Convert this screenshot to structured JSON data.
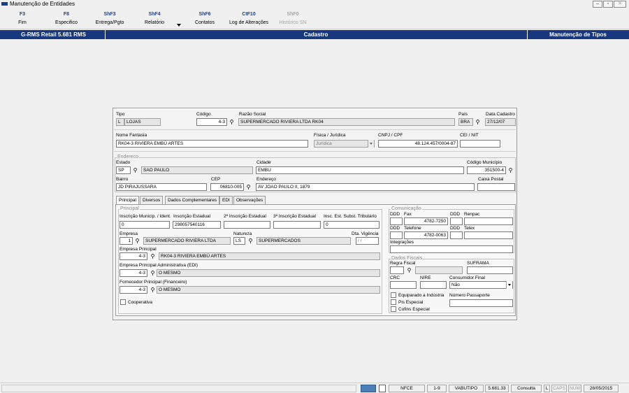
{
  "window": {
    "title": "Manutenção de Entidades"
  },
  "toolbar": [
    {
      "key": "F3",
      "label": "Fim",
      "enabled": true
    },
    {
      "key": "F8",
      "label": "Especifico",
      "enabled": true
    },
    {
      "key": "ShF3",
      "label": "Entrega/Pgto",
      "enabled": true
    },
    {
      "key": "ShF4",
      "label": "Relatório",
      "enabled": true
    },
    {
      "key": "ShF6",
      "label": "Contatos",
      "enabled": true
    },
    {
      "key": "CtF10",
      "label": "Log de Alterações",
      "enabled": true
    },
    {
      "key": "ShF0",
      "label": "Histórico SN",
      "enabled": false
    }
  ],
  "header": {
    "left": "G-RMS Retail 5.681 RMS",
    "center": "Cadastro",
    "right": "Manutenção de Tipos"
  },
  "form": {
    "tipo": {
      "label": "Tipo",
      "code": "L",
      "name": "LOJAS"
    },
    "codigo": {
      "label": "Código",
      "value": "4-3"
    },
    "razao": {
      "label": "Razão Social",
      "value": "SUPERMERCADO RIVIERA LTDA RK04"
    },
    "pais": {
      "label": "País",
      "value": "BRA"
    },
    "data_cadastro": {
      "label": "Data Cadastro",
      "value": "27/12/07"
    },
    "fantasia": {
      "label": "Nome Fantasia",
      "value": "RK04-3 RIVIERA EMBÚ ARTES"
    },
    "fisica": {
      "label": "Física / Jurídica",
      "value": "Jurídica"
    },
    "cnpj": {
      "label": "CNPJ / CPF",
      "value": "48.124.457/0004-87"
    },
    "cei": {
      "label": "CEI / NIT",
      "value": ""
    },
    "endereco_group": "Endereco",
    "estado": {
      "label": "Estado",
      "code": "SP",
      "name": "SAO PAULO"
    },
    "cidade": {
      "label": "Cidade",
      "value": "EMBU"
    },
    "municipio": {
      "label": "Código Município",
      "value": "351500-4"
    },
    "bairro": {
      "label": "Bairro",
      "value": "JD PIRAJUSSARA"
    },
    "cep": {
      "label": "CEP",
      "value": "06810-005"
    },
    "endereco": {
      "label": "Endereço",
      "value": "AV JOAO PAULO II, 1879"
    },
    "caixa": {
      "label": "Caixa Postal",
      "value": ""
    }
  },
  "tabs": [
    "Principal",
    "Diversos",
    "Dados Complementares",
    "EDI",
    "Observações"
  ],
  "principal": {
    "group": "Principal",
    "insc_mun": {
      "label": "Inscrição Municip. / Ident.",
      "value": "0"
    },
    "insc_est": {
      "label": "Inscrição Estadual",
      "value": "298057540116"
    },
    "insc_est2": {
      "label": "2ª Inscrição Estadual",
      "value": ""
    },
    "insc_est3": {
      "label": "3ª Inscrição Estadual",
      "value": ""
    },
    "insc_subst": {
      "label": "Insc. Est. Subst. Tributário",
      "value": "0"
    },
    "empresa": {
      "label": "Empresa",
      "code": "1",
      "name": "SUPERMERCADO RIVIERA LTDA"
    },
    "natureza": {
      "label": "Natureza",
      "code": "LS",
      "name": "SUPERMERCADOS"
    },
    "vigencia": {
      "label": "Dta. Vigência",
      "value": "/ /"
    },
    "emp_principal": {
      "label": "Empresa Principal",
      "code": "4-3",
      "name": "RK04-3 RIVIERA EMBÚ ARTES"
    },
    "emp_adm": {
      "label": "Empresa Principal Administrativa (EDI)",
      "code": "4-3",
      "name": "O MESMO"
    },
    "fornecedor": {
      "label": "Fornecedor Principal (Financeiro)",
      "code": "4-3",
      "name": "O MESMO"
    },
    "cooperativa": "Cooperativa"
  },
  "comunicacao": {
    "group": "Comunicação",
    "ddd1": "DDD",
    "fax_label": "Fax",
    "fax": "4782-7250",
    "ddd2": "DDD",
    "renpac": "Renpac",
    "ddd3": "DDD",
    "tel_label": "Telefone",
    "tel": "4782-0063",
    "ddd4": "DDD",
    "telex": "Telex",
    "integracoes": "Integrações"
  },
  "fiscais": {
    "group": "Dados Fiscais",
    "regra": "Regra Fiscal",
    "suframa": "SUFRAMA",
    "crc": "CRC",
    "nire": "NIRE",
    "consumidor_label": "Consumidor Final",
    "consumidor": "Não",
    "equiparado": "Equiparado a Indústria",
    "passaporte": "Número Passaporte",
    "pis": "Pis Especial",
    "cofins": "Cofins Especial"
  },
  "status": {
    "nfce": "NFCE",
    "range": "1-9",
    "user": "VABUTIPO",
    "version": "5.681.33",
    "mode": "Consulta",
    "l": "L",
    "caps": "CAPS",
    "num": "NUM",
    "date": "28/05/2015"
  }
}
